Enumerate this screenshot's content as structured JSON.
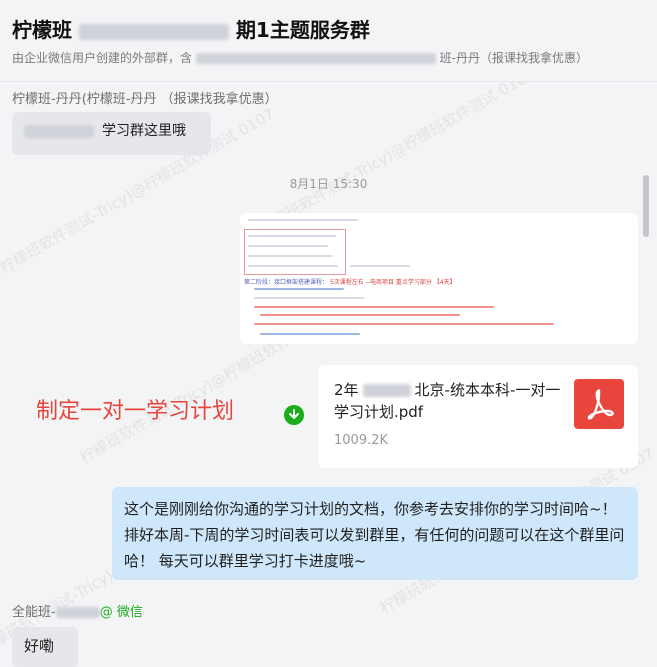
{
  "header": {
    "title_prefix": "柠檬班",
    "title_suffix": "期1主题服务群",
    "subtitle_prefix": "由企业微信用户创建的外部群，含",
    "subtitle_suffix": "班-丹丹（报课找我拿优惠）"
  },
  "messages": {
    "m1_sender": "柠檬班-丹丹(柠檬班-丹丹 （报课找我拿优惠）",
    "m1_text": "学习群这里哦",
    "timestamp": "8月1日 15:30",
    "screenshot_heading_a": "第二阶段：接口框架搭建课程：",
    "screenshot_heading_b": "5次课程左右 --电商项目 重点学习部分 【4天】",
    "plan_label": "制定一对一学习计划",
    "file_name_a": "2年",
    "file_name_b": "北京-统本本科-一对一学习计划.pdf",
    "file_size": "1009.2K",
    "long_text": "这个是刚刚给你沟通的学习计划的文档，你参考去安排你的学习时间哈~！ 排好本周-下周的学习时间表可以发到群里，有任何的问题可以在这个群里问哈！ 每天可以群里学习打卡进度哦~",
    "m3_sender_prefix": "全能班-",
    "m3_sender_tag": "@ 微信",
    "m3_text": "好嘞"
  },
  "watermark": "柠檬班软件测试-Tricy)@柠檬班软件测试 0107",
  "colors": {
    "accent_red": "#e8453c",
    "wechat_green": "#1aad19",
    "blue_bubble": "#cfe7fb"
  },
  "icons": {
    "file_type": "pdf-icon",
    "download": "download-icon"
  }
}
